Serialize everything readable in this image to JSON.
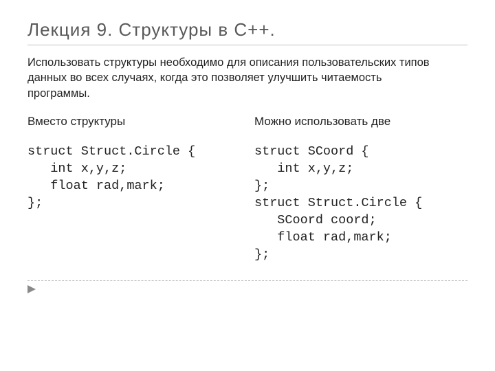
{
  "title": "Лекция 9. Структуры в С++.",
  "intro": "Использовать  структуры необходимо для описания пользовательских типов данных во всех случаях, когда это позволяет улучшить читаемость программы.",
  "columns": {
    "left": {
      "heading": "Вместо структуры",
      "code": "struct Struct.Circle {\n   int x,y,z;\n   float rad,mark;\n};"
    },
    "right": {
      "heading": "Можно использовать две",
      "code": "struct SCoord {\n   int x,y,z;\n};\nstruct Struct.Circle {\n   SCoord coord;\n   float rad,mark;\n};"
    }
  }
}
